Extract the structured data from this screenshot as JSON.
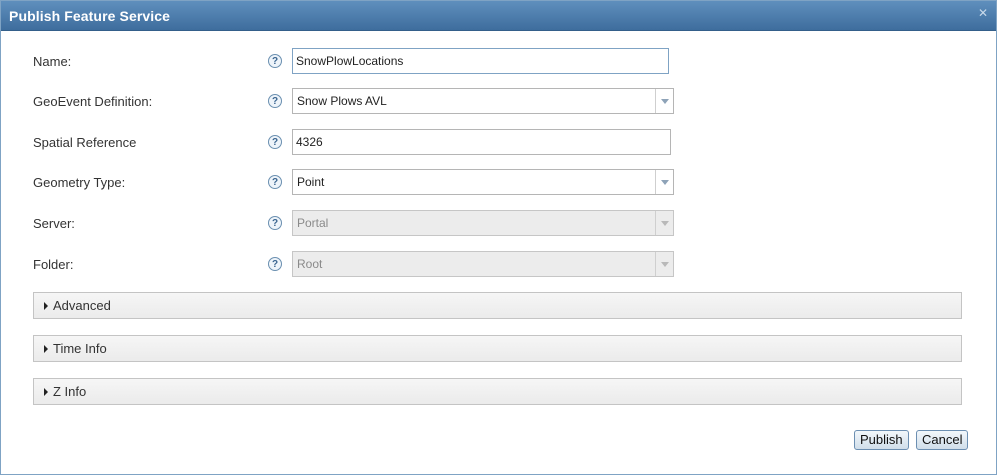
{
  "dialog": {
    "title": "Publish Feature Service",
    "close_glyph": "✕",
    "help_glyph": "?"
  },
  "form": {
    "name": {
      "label": "Name:",
      "value": "SnowPlowLocations"
    },
    "geoevent_definition": {
      "label": "GeoEvent Definition:",
      "value": "Snow Plows AVL"
    },
    "spatial_reference": {
      "label": "Spatial Reference",
      "value": "4326"
    },
    "geometry_type": {
      "label": "Geometry Type:",
      "value": "Point"
    },
    "server": {
      "label": "Server:",
      "value": "Portal"
    },
    "folder": {
      "label": "Folder:",
      "value": "Root"
    }
  },
  "sections": {
    "advanced": "Advanced",
    "time_info": "Time Info",
    "z_info": "Z Info"
  },
  "buttons": {
    "publish": "Publish",
    "cancel": "Cancel"
  },
  "icons": {
    "close": "close-icon",
    "help": "help-icon",
    "dropdown": "chevron-down-icon",
    "expand": "caret-right-icon"
  }
}
